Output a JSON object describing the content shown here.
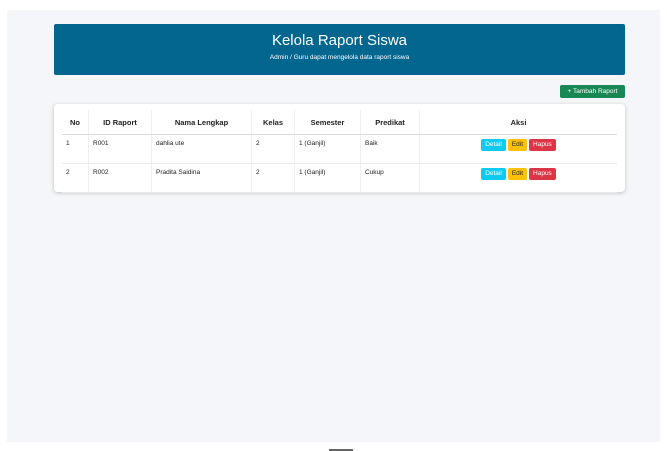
{
  "header": {
    "title": "Kelola Raport Siswa",
    "subtitle": "Admin / Guru dapat mengelola data raport siswa"
  },
  "actions": {
    "add_label": "+ Tambah Raport"
  },
  "table": {
    "headers": [
      "No",
      "ID Raport",
      "Nama Lengkap",
      "Kelas",
      "Semester",
      "Predikat",
      "Aksi"
    ],
    "rows": [
      {
        "no": "1",
        "id": "R001",
        "nama": "dahlia ute",
        "kelas": "2",
        "semester": "1 (Ganjil)",
        "predikat": "Baik"
      },
      {
        "no": "2",
        "id": "R002",
        "nama": "Pradita Saidina",
        "kelas": "2",
        "semester": "1 (Ganjil)",
        "predikat": "Cukup"
      }
    ],
    "row_actions": {
      "detail": "Detail",
      "edit": "Edit",
      "hapus": "Hapus"
    }
  },
  "colors": {
    "header_bg": "#03668f",
    "add_button": "#198754",
    "detail_button": "#0dcaf0",
    "edit_button": "#ffc107",
    "delete_button": "#dc3545"
  }
}
